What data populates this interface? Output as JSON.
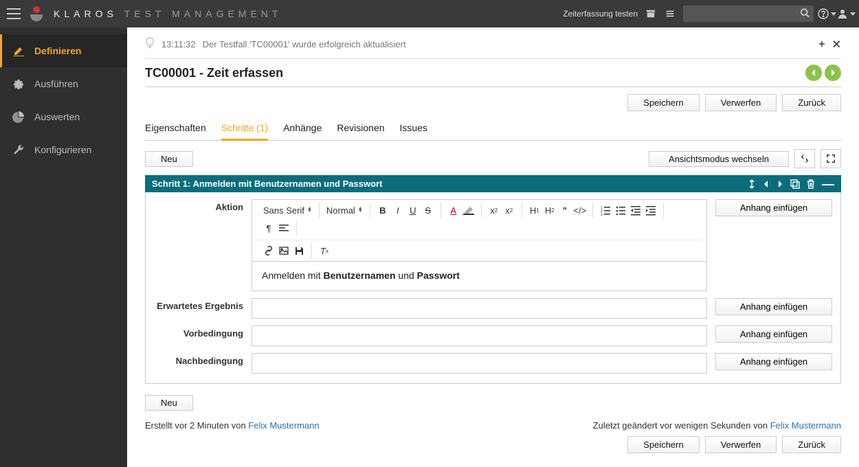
{
  "topbar": {
    "brand_strong": "KLAROS",
    "brand_light": "TEST MANAGEMENT",
    "timing_link": "Zeiterfassung testen",
    "search_placeholder": ""
  },
  "sidebar": {
    "items": [
      {
        "label": "Definieren"
      },
      {
        "label": "Ausführen"
      },
      {
        "label": "Auswerten"
      },
      {
        "label": "Konfigurieren"
      }
    ]
  },
  "notification": {
    "time": "13:11:32",
    "text": "Der Testfall 'TC00001' wurde erfolgreich aktualisiert"
  },
  "title": "TC00001 - Zeit erfassen",
  "buttons": {
    "save": "Speichern",
    "discard": "Verwerfen",
    "back": "Zurück",
    "new": "Neu",
    "switch_view": "Ansichtsmodus wechseln",
    "attach": "Anhang einfügen"
  },
  "tabs": [
    {
      "label": "Eigenschaften"
    },
    {
      "label": "Schritte (1)"
    },
    {
      "label": "Anhänge"
    },
    {
      "label": "Revisionen"
    },
    {
      "label": "Issues"
    }
  ],
  "step": {
    "header": "Schritt 1: Anmelden mit Benutzernamen und Passwort",
    "labels": {
      "action": "Aktion",
      "expected": "Erwartetes Ergebnis",
      "precondition": "Vorbedingung",
      "postcondition": "Nachbedingung"
    },
    "action_plain1": "Anmelden mit ",
    "action_bold1": "Benutzernamen",
    "action_plain2": " und ",
    "action_bold2": "Passwort",
    "expected_value": "",
    "precondition_value": "",
    "postcondition_value": ""
  },
  "editor": {
    "font": "Sans Serif",
    "size": "Normal"
  },
  "footer": {
    "created_prefix": "Erstellt vor 2 Minuten von ",
    "created_user": "Felix Mustermann",
    "changed_prefix": "Zuletzt geändert vor wenigen Sekunden von ",
    "changed_user": "Felix Mustermann"
  }
}
